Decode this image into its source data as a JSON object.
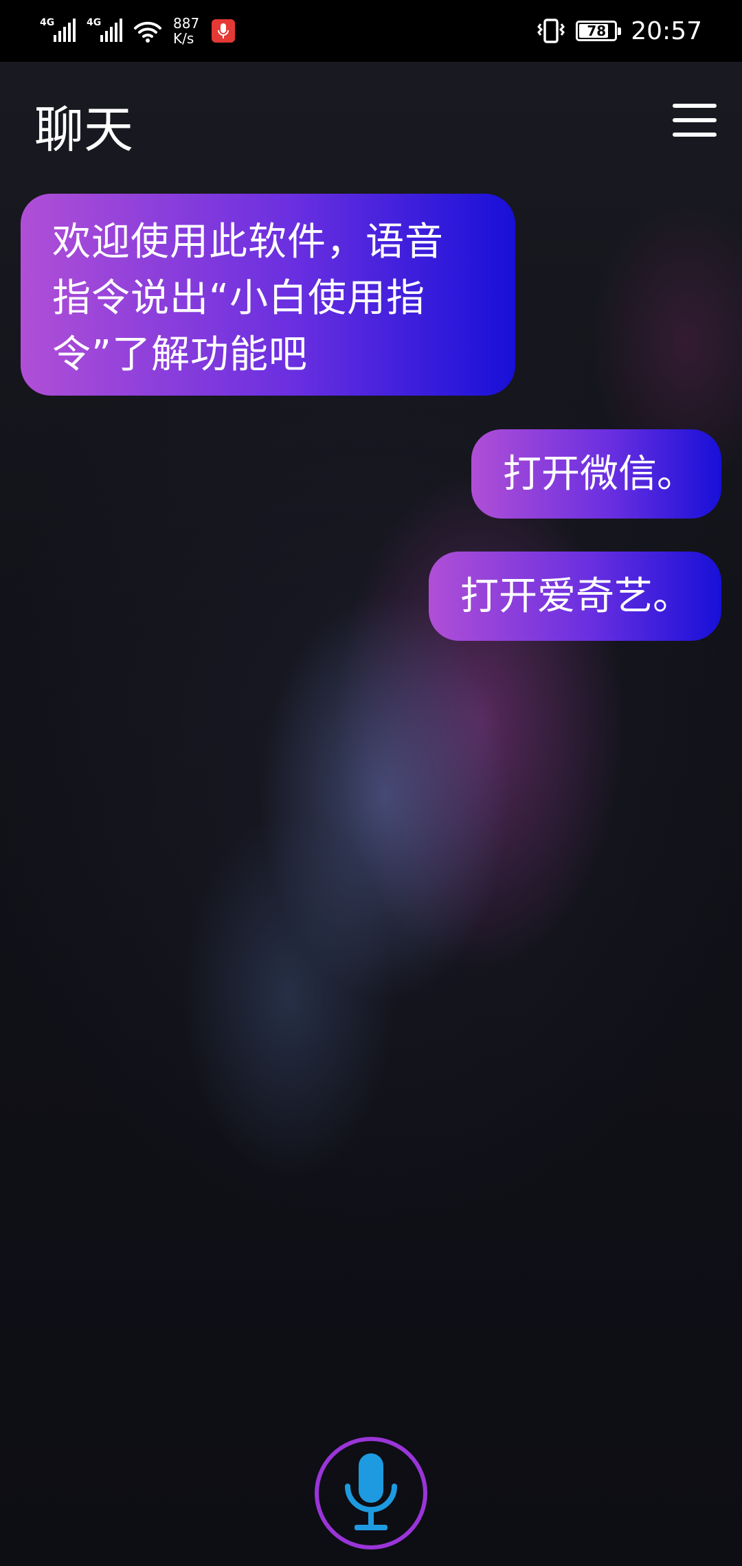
{
  "status_bar": {
    "signal_1_label": "4G",
    "signal_2_label": "4G",
    "net_speed_value": "887",
    "net_speed_unit": "K/s",
    "battery_level": "78",
    "time": "20:57",
    "icons": [
      "signal-icon",
      "wifi-icon",
      "mic-recording-icon",
      "vibrate-icon",
      "battery-icon"
    ]
  },
  "header": {
    "title": "聊天",
    "menu_icon": "hamburger-menu-icon"
  },
  "messages": [
    {
      "sender": "assistant",
      "text_lines": [
        "欢迎使用此软件，语音",
        "指令说出“小白使用指",
        "令”了解功能吧"
      ]
    },
    {
      "sender": "user",
      "text": "打开微信。"
    },
    {
      "sender": "user",
      "text": "打开爱奇艺。"
    }
  ],
  "mic_button": {
    "icon": "microphone-icon"
  },
  "colors": {
    "bubble_start": "#b04fd6",
    "bubble_end": "#1810d8",
    "mic_ring": "#9a35d8",
    "mic_icon": "#1e9be0",
    "status_mic_badge": "#e53935"
  }
}
